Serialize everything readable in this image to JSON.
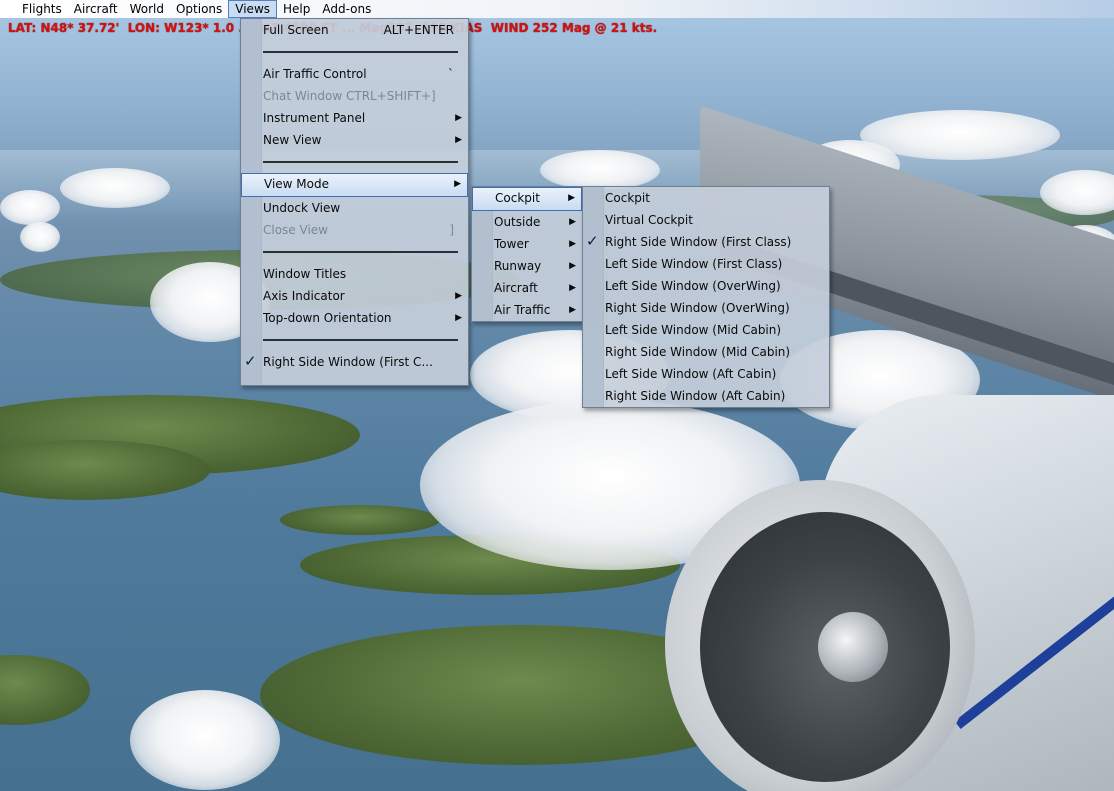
{
  "menubar": {
    "items": [
      "Flights",
      "Aircraft",
      "World",
      "Options",
      "Views",
      "Help",
      "Add-ons"
    ]
  },
  "hud": {
    "text": "LAT: N48* 37.72'  LON: W123* 1.0 ... ALT 4500 FT ... Mag337  198 KIAS  WIND 252 Mag @ 21 kts."
  },
  "views_menu": {
    "full_screen": "Full Screen",
    "full_screen_shortcut": "ALT+ENTER",
    "air_traffic_control": "Air Traffic Control",
    "air_traffic_control_shortcut": "`",
    "chat_window": "Chat Window CTRL+SHIFT+]",
    "instrument_panel": "Instrument Panel",
    "new_view": "New View",
    "view_mode": "View Mode",
    "undock_view": "Undock View",
    "close_view": "Close View",
    "close_view_shortcut": "]",
    "window_titles": "Window Titles",
    "axis_indicator": "Axis Indicator",
    "top_down_orientation": "Top-down Orientation",
    "current_view": "Right Side Window (First C..."
  },
  "view_mode_menu": {
    "items": [
      "Cockpit",
      "Outside",
      "Tower",
      "Runway",
      "Aircraft",
      "Air Traffic"
    ]
  },
  "cockpit_menu": {
    "items": [
      "Cockpit",
      "Virtual Cockpit",
      "Right Side Window (First Class)",
      "Left Side Window (First Class)",
      "Left Side Window (OverWing)",
      "Right Side Window (OverWing)",
      "Left Side Window (Mid Cabin)",
      "Right Side Window (Mid Cabin)",
      "Left Side Window (Aft Cabin)",
      "Right Side Window (Aft Cabin)"
    ],
    "checked_index": 2
  },
  "icons": {
    "submenu_arrow": "arrow-right-icon",
    "check": "checkmark-icon"
  },
  "colors": {
    "hud_text": "#d41010",
    "highlight_border": "#3e6fb4"
  }
}
